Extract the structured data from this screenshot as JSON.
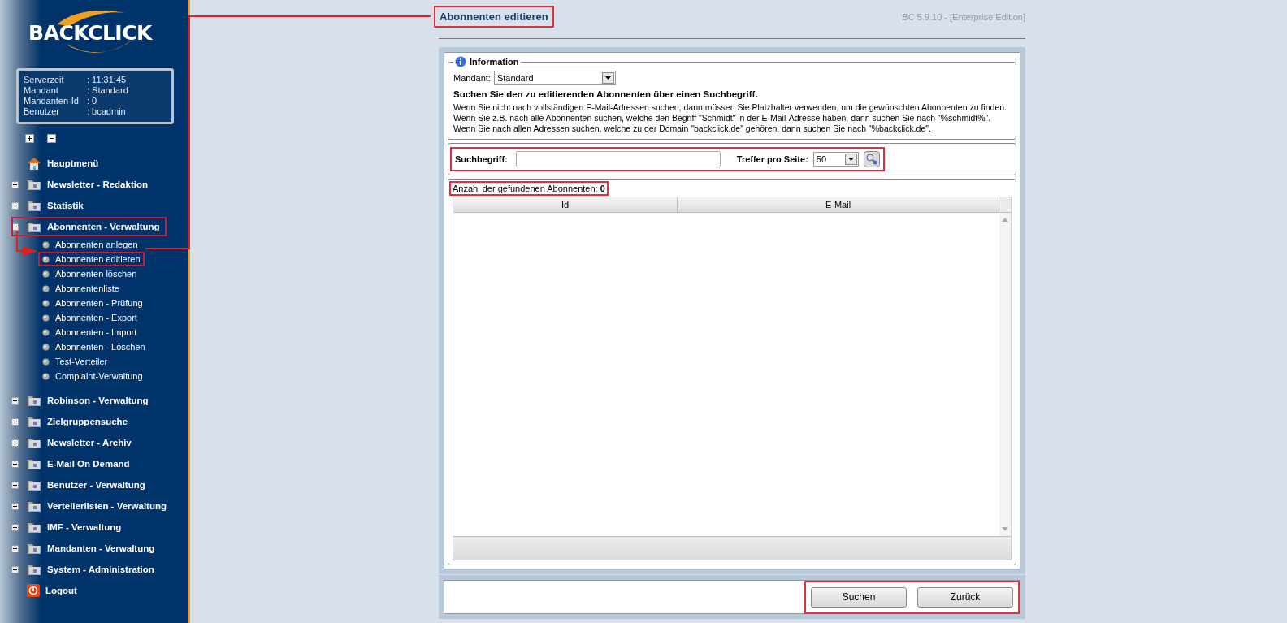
{
  "sidebar": {
    "logo": "BACKCLICK",
    "server_info": [
      {
        "label": "Serverzeit",
        "value": ": 11:31:45"
      },
      {
        "label": "Mandant",
        "value": ": Standard"
      },
      {
        "label": "Mandanten-Id",
        "value": ": 0"
      },
      {
        "label": "Benutzer",
        "value": ": bcadmin"
      }
    ],
    "menu": [
      {
        "label": "Hauptmenü",
        "kind": "home"
      },
      {
        "label": "Newsletter - Redaktion",
        "kind": "folder",
        "expanded": false,
        "highlighted": false
      },
      {
        "label": "Statistik",
        "kind": "folder",
        "expanded": false,
        "highlighted": false
      },
      {
        "label": "Abonnenten - Verwaltung",
        "kind": "folder",
        "expanded": true,
        "highlighted": true,
        "children": [
          {
            "label": "Abonnenten anlegen",
            "highlighted": false
          },
          {
            "label": "Abonnenten editieren",
            "highlighted": true
          },
          {
            "label": "Abonnenten löschen",
            "highlighted": false
          },
          {
            "label": "Abonnentenliste",
            "highlighted": false
          },
          {
            "label": "Abonnenten - Prüfung",
            "highlighted": false
          },
          {
            "label": "Abonnenten - Export",
            "highlighted": false
          },
          {
            "label": "Abonnenten - Import",
            "highlighted": false
          },
          {
            "label": "Abonnenten - Löschen",
            "highlighted": false
          },
          {
            "label": "Test-Verteiler",
            "highlighted": false
          },
          {
            "label": "Complaint-Verwaltung",
            "highlighted": false
          }
        ]
      },
      {
        "label": "Robinson - Verwaltung",
        "kind": "folder",
        "expanded": false,
        "highlighted": false
      },
      {
        "label": "Zielgruppensuche",
        "kind": "folder",
        "expanded": false,
        "highlighted": false
      },
      {
        "label": "Newsletter - Archiv",
        "kind": "folder",
        "expanded": false,
        "highlighted": false
      },
      {
        "label": "E-Mail On Demand",
        "kind": "folder",
        "expanded": false,
        "highlighted": false
      },
      {
        "label": "Benutzer - Verwaltung",
        "kind": "folder",
        "expanded": false,
        "highlighted": false
      },
      {
        "label": "Verteilerlisten - Verwaltung",
        "kind": "folder",
        "expanded": false,
        "highlighted": false
      },
      {
        "label": "IMF - Verwaltung",
        "kind": "folder",
        "expanded": false,
        "highlighted": false
      },
      {
        "label": "Mandanten - Verwaltung",
        "kind": "folder",
        "expanded": false,
        "highlighted": false
      },
      {
        "label": "System - Administration",
        "kind": "folder",
        "expanded": false,
        "highlighted": false
      },
      {
        "label": "Logout",
        "kind": "logout"
      }
    ]
  },
  "page_title": {
    "text": "Abonnenten editieren",
    "highlighted": true
  },
  "version": "BC 5.9.10 - [Enterprise Edition]",
  "information": {
    "legend": "Information",
    "mandant_label": "Mandant:",
    "mandant_value": "Standard",
    "heading": "Suchen Sie den zu editierenden Abonnenten über einen Suchbegriff.",
    "text": "Wenn Sie nicht nach vollständigen E-Mail-Adressen suchen, dann müssen Sie Platzhalter verwenden, um die gewünschten Abonnenten zu finden. Wenn Sie z.B. nach alle Abonnenten suchen, welche den Begriff \"Schmidt\" in der E-Mail-Adresse haben, dann suchen Sie nach \"%schmidt%\". Wenn Sie nach allen Adressen suchen, welche zu der Domain \"backclick.de\" gehören, dann suchen Sie nach \"%backclick.de\"."
  },
  "search": {
    "label": "Suchbegriff:",
    "per_page_label": "Treffer pro Seite:",
    "per_page_value": "50",
    "highlighted": true
  },
  "results": {
    "count": "Anzahl der gefundenen Abonnenten: **0**",
    "highlighted": true,
    "columns": [
      "Id",
      "E-Mail"
    ]
  },
  "buttons": {
    "highlighted": true,
    "items": [
      "Suchen",
      "Zurück"
    ]
  }
}
